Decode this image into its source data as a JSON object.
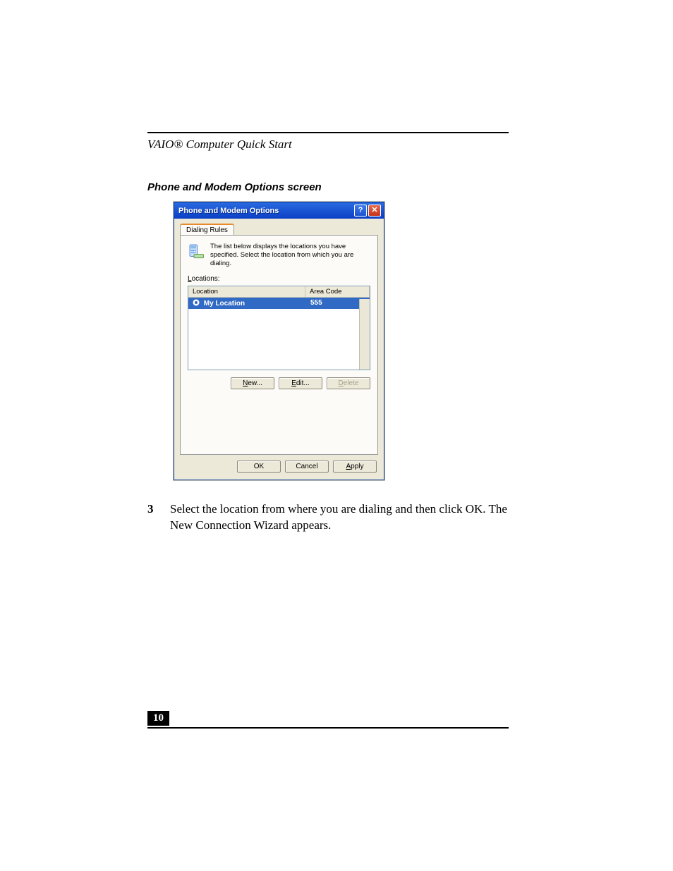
{
  "document": {
    "running_head": "VAIO® Computer Quick Start",
    "section_caption": "Phone and Modem Options screen",
    "page_number": "10"
  },
  "dialog": {
    "title": "Phone and Modem Options",
    "help_glyph": "?",
    "close_glyph": "✕",
    "tabs": {
      "dialing_rules": "Dialing Rules"
    },
    "info_text": "The list below displays the locations you have specified. Select the location from which you are dialing.",
    "locations_label": "Locations:",
    "columns": {
      "location": "Location",
      "area_code": "Area Code"
    },
    "rows": [
      {
        "name": "My Location",
        "area_code": "555"
      }
    ],
    "buttons": {
      "new": "New...",
      "edit": "Edit...",
      "delete": "Delete",
      "ok": "OK",
      "cancel": "Cancel",
      "apply": "Apply"
    },
    "underlines": {
      "new_prefix": "N",
      "edit_prefix": "E",
      "delete_prefix": "D",
      "apply_prefix": "A",
      "locations_prefix": "L"
    }
  },
  "step": {
    "number": "3",
    "text": "Select the location from where you are dialing and then click OK. The New Connection Wizard appears."
  }
}
